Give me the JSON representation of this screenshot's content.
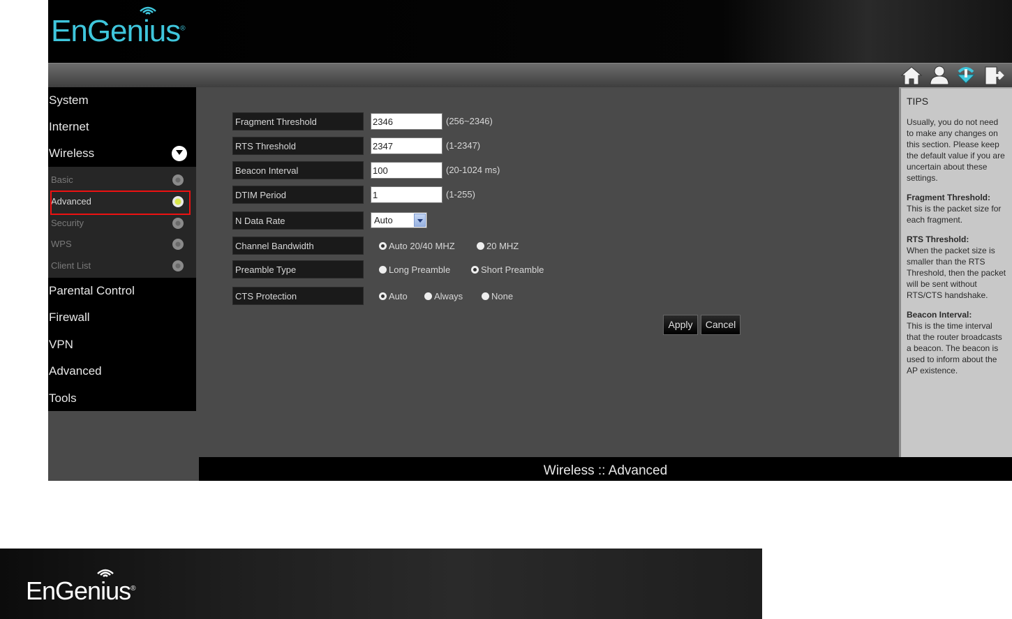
{
  "brand": {
    "name_prefix": "EnGen",
    "name_i": "i",
    "name_suffix": "us",
    "reg": "®",
    "color": "#3fc6dc"
  },
  "toolbar": {
    "icons": [
      "home-icon",
      "user-icon",
      "update-icon",
      "logout-icon"
    ]
  },
  "sidebar": {
    "items": [
      "System",
      "Internet",
      "Wireless",
      "Parental Control",
      "Firewall",
      "VPN",
      "Advanced",
      "Tools"
    ],
    "wireless_sub": [
      "Basic",
      "Advanced",
      "Security",
      "WPS",
      "Client List"
    ],
    "active_sub": "Advanced"
  },
  "form": {
    "fragment": {
      "label": "Fragment Threshold",
      "value": "2346",
      "hint": "(256~2346)"
    },
    "rts": {
      "label": "RTS Threshold",
      "value": "2347",
      "hint": "(1-2347)"
    },
    "beacon": {
      "label": "Beacon Interval",
      "value": "100",
      "hint": "(20-1024 ms)"
    },
    "dtim": {
      "label": "DTIM Period",
      "value": "1",
      "hint": "(1-255)"
    },
    "ndata": {
      "label": "N Data Rate",
      "value": "Auto"
    },
    "channel": {
      "label": "Channel Bandwidth",
      "opt1": "Auto 20/40 MHZ",
      "opt2": "20 MHZ"
    },
    "preamble": {
      "label": "Preamble Type",
      "opt1": "Long Preamble",
      "opt2": "Short Preamble"
    },
    "cts": {
      "label": "CTS Protection",
      "opt1": "Auto",
      "opt2": "Always",
      "opt3": "None"
    },
    "apply_label": "Apply",
    "cancel_label": "Cancel"
  },
  "tips": {
    "title": "TIPS",
    "intro": "Usually, you do not need to make any changes on this section. Please keep the default value if you are uncertain about these settings.",
    "fragment_head": "Fragment Threshold:",
    "fragment_body": "This is the packet size for each fragment.",
    "rts_head": "RTS Threshold:",
    "rts_body": "When the packet size is smaller than the RTS Threshold, then the packet will be sent without RTS/CTS handshake.",
    "beacon_head": "Beacon Interval:",
    "beacon_body": "This is the time interval that the router broadcasts a beacon. The beacon is used to inform about the AP existence."
  },
  "status": {
    "text": "Wireless :: Advanced"
  }
}
